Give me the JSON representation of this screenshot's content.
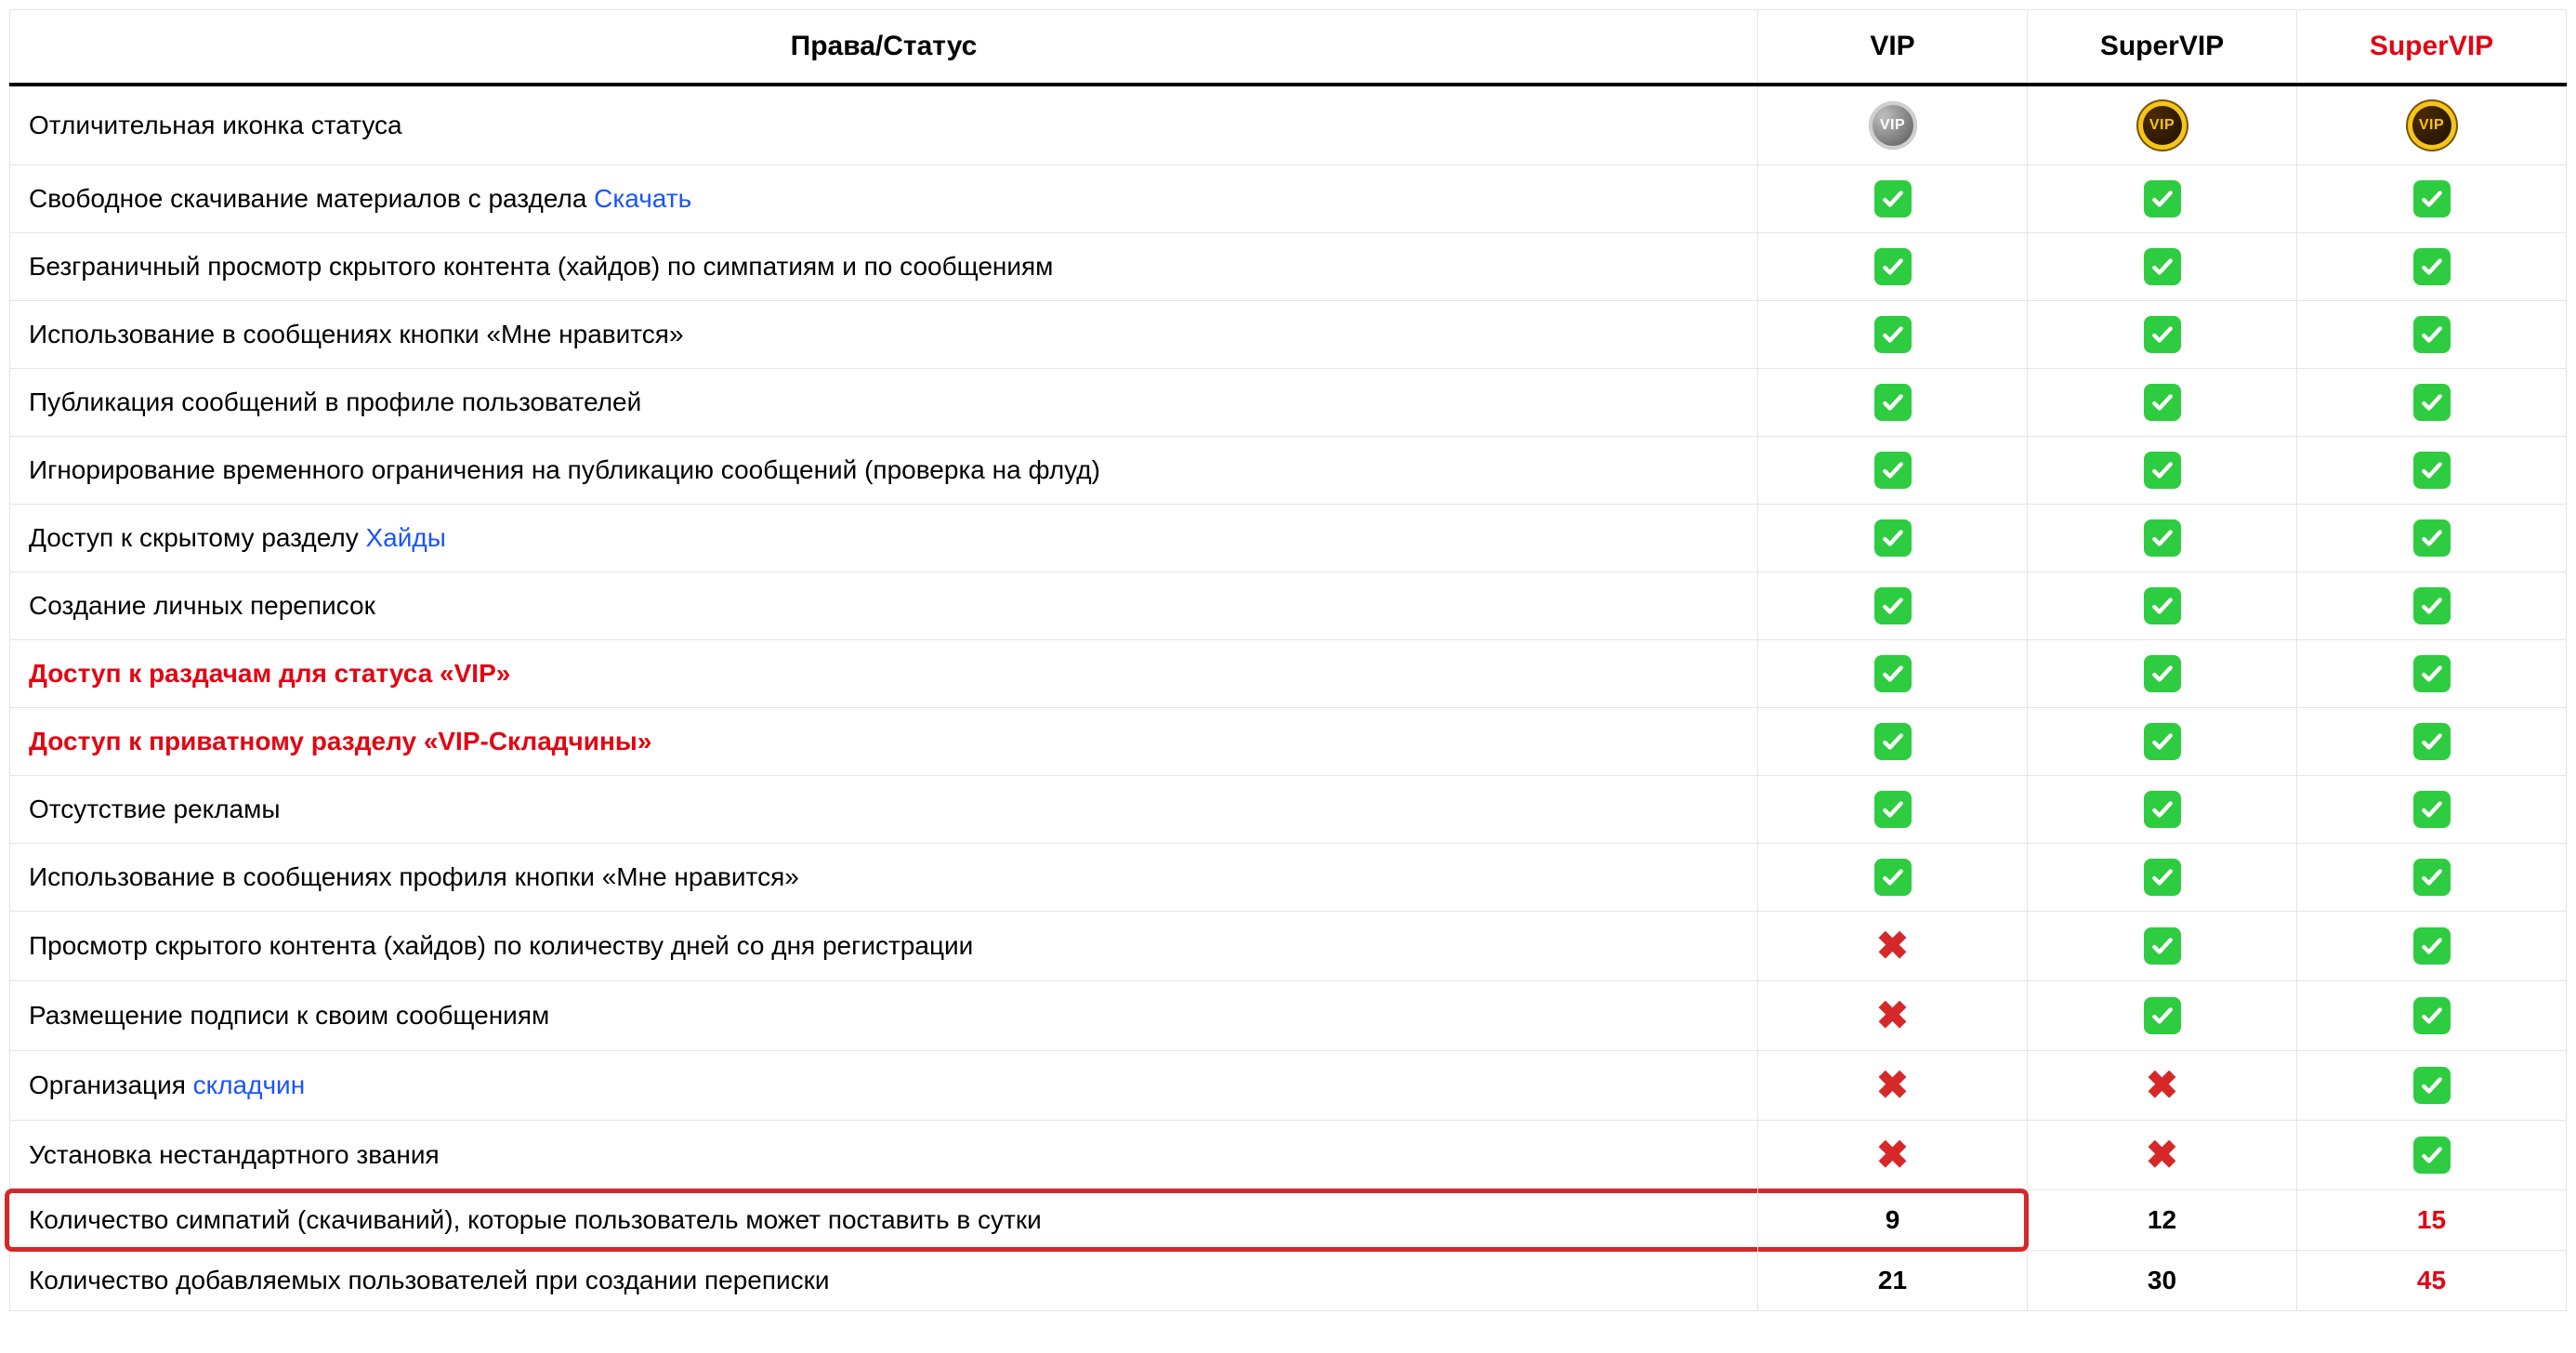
{
  "header": {
    "rights_label": "Права/Статус",
    "tiers": [
      {
        "label": "VIP",
        "red": false
      },
      {
        "label": "SuperVIP",
        "red": false
      },
      {
        "label": "SuperVIP",
        "red": true
      }
    ]
  },
  "badge_text": "VIP",
  "rows": [
    {
      "type": "badges",
      "label_parts": [
        {
          "text": "Отличительная иконка статуса"
        }
      ],
      "cells": [
        "badge-silver",
        "badge-gold",
        "badge-gold"
      ]
    },
    {
      "label_parts": [
        {
          "text": "Свободное скачивание материалов с раздела "
        },
        {
          "text": "Скачать",
          "link": true
        }
      ],
      "cells": [
        "check",
        "check",
        "check"
      ]
    },
    {
      "label_parts": [
        {
          "text": "Безграничный просмотр скрытого контента (хайдов) по симпатиям и по сообщениям"
        }
      ],
      "cells": [
        "check",
        "check",
        "check"
      ]
    },
    {
      "label_parts": [
        {
          "text": "Использование в сообщениях кнопки «Мне нравится»"
        }
      ],
      "cells": [
        "check",
        "check",
        "check"
      ]
    },
    {
      "label_parts": [
        {
          "text": "Публикация сообщений в профиле пользователей"
        }
      ],
      "cells": [
        "check",
        "check",
        "check"
      ]
    },
    {
      "label_parts": [
        {
          "text": "Игнорирование временного ограничения на публикацию сообщений (проверка на флуд)"
        }
      ],
      "cells": [
        "check",
        "check",
        "check"
      ]
    },
    {
      "label_parts": [
        {
          "text": "Доступ к скрытому разделу "
        },
        {
          "text": "Хайды",
          "link": true
        }
      ],
      "cells": [
        "check",
        "check",
        "check"
      ]
    },
    {
      "label_parts": [
        {
          "text": "Создание личных переписок"
        }
      ],
      "cells": [
        "check",
        "check",
        "check"
      ]
    },
    {
      "label_parts": [
        {
          "text": "Доступ к раздачам для статуса «VIP»",
          "red_bold": true
        }
      ],
      "cells": [
        "check",
        "check",
        "check"
      ]
    },
    {
      "label_parts": [
        {
          "text": "Доступ к приватному разделу «VIP-Складчины»",
          "red_bold": true
        }
      ],
      "cells": [
        "check",
        "check",
        "check"
      ]
    },
    {
      "label_parts": [
        {
          "text": "Отсутствие рекламы"
        }
      ],
      "cells": [
        "check",
        "check",
        "check"
      ]
    },
    {
      "label_parts": [
        {
          "text": "Использование в сообщениях профиля кнопки «Мне нравится»"
        }
      ],
      "cells": [
        "check",
        "check",
        "check"
      ]
    },
    {
      "label_parts": [
        {
          "text": "Просмотр скрытого контента (хайдов) по количеству дней со дня регистрации"
        }
      ],
      "cells": [
        "cross",
        "check",
        "check"
      ]
    },
    {
      "label_parts": [
        {
          "text": "Размещение подписи к своим сообщениям"
        }
      ],
      "cells": [
        "cross",
        "check",
        "check"
      ]
    },
    {
      "label_parts": [
        {
          "text": "Организация "
        },
        {
          "text": "складчин",
          "link": true
        }
      ],
      "cells": [
        "cross",
        "cross",
        "check"
      ]
    },
    {
      "label_parts": [
        {
          "text": "Установка нестандартного звания"
        }
      ],
      "cells": [
        "cross",
        "cross",
        "check"
      ]
    },
    {
      "highlight": true,
      "label_parts": [
        {
          "text": "Количество симпатий (скачиваний), которые пользователь может поставить в сутки"
        }
      ],
      "cells": [
        "9",
        "12",
        "15"
      ],
      "numeric": true
    },
    {
      "label_parts": [
        {
          "text": "Количество добавляемых пользователей при создании переписки"
        }
      ],
      "cells": [
        "21",
        "30",
        "45"
      ],
      "numeric": true
    }
  ]
}
